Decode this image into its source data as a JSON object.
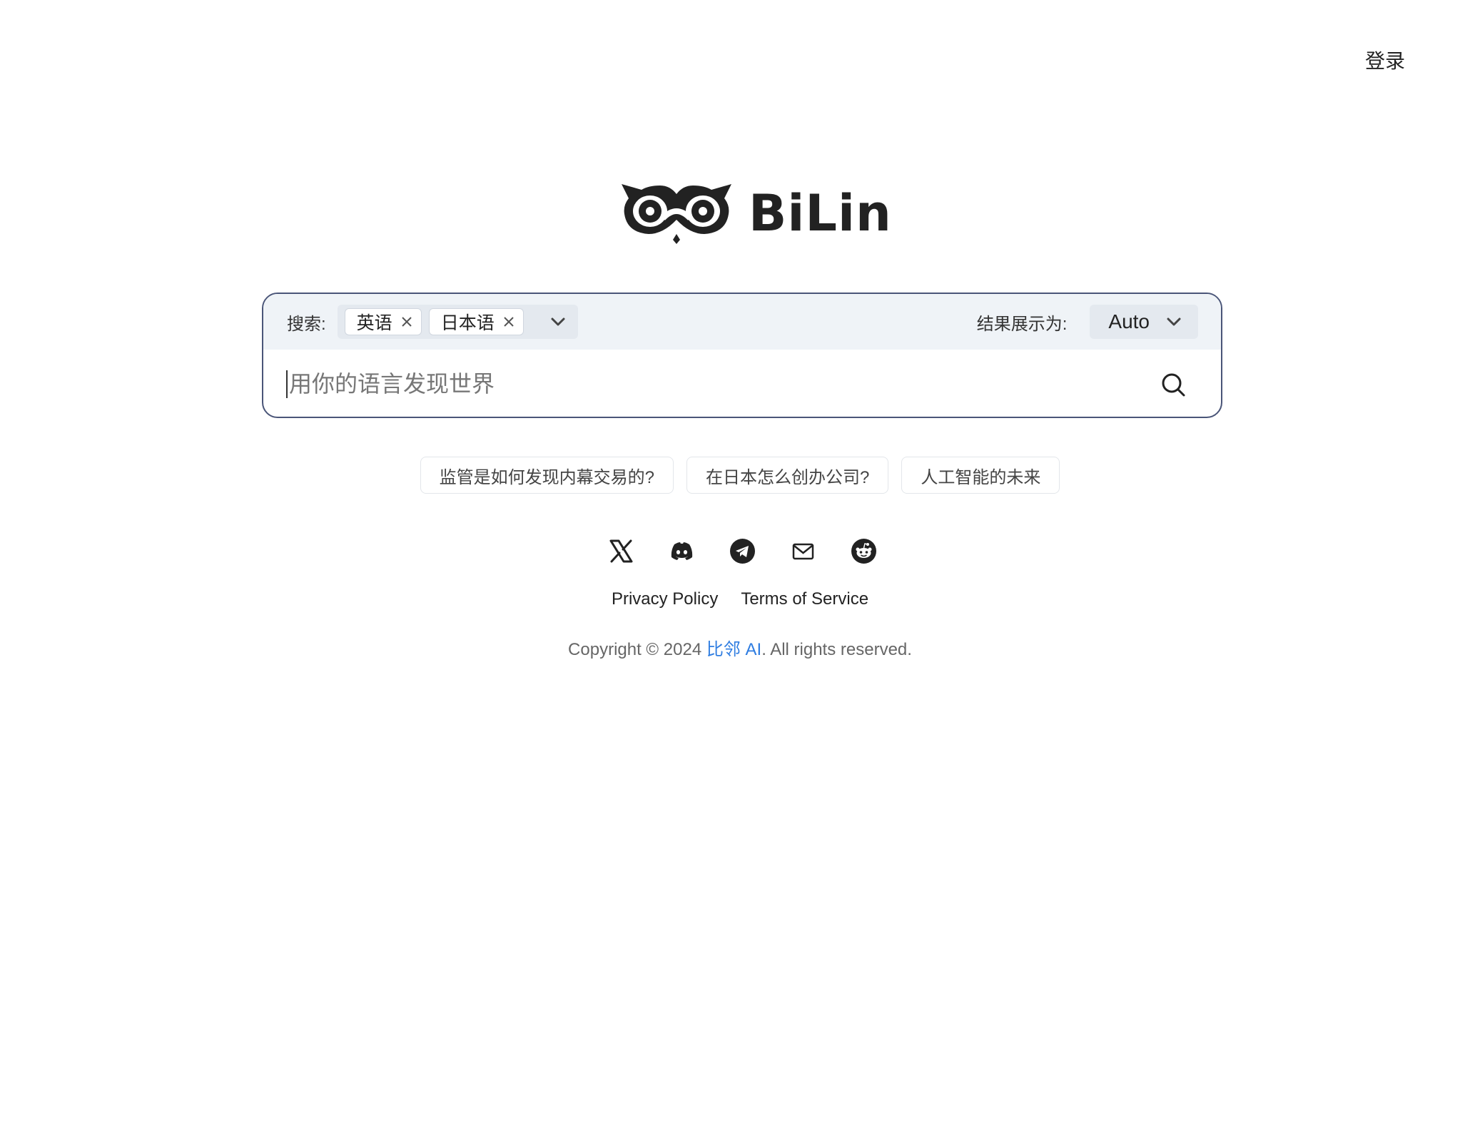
{
  "header": {
    "login_label": "登录"
  },
  "logo": {
    "text": "BiLin"
  },
  "search": {
    "label": "搜索:",
    "languages": [
      {
        "label": "英语"
      },
      {
        "label": "日本语"
      }
    ],
    "display_label": "结果展示为:",
    "display_value": "Auto",
    "placeholder": "用你的语言发现世界"
  },
  "suggestions": [
    "监管是如何发现内幕交易的?",
    "在日本怎么创办公司?",
    "人工智能的未来"
  ],
  "socials": [
    "x-icon",
    "discord-icon",
    "telegram-icon",
    "mail-icon",
    "reddit-icon"
  ],
  "footer": {
    "privacy": "Privacy Policy",
    "terms": "Terms of Service",
    "copyright_prefix": "Copyright © 2024 ",
    "brand": "比邻 AI",
    "copyright_suffix": ". All rights reserved."
  },
  "colors": {
    "accent": "#2f7de1",
    "border": "#4a5578",
    "toolbar_bg": "#eff3f7"
  }
}
